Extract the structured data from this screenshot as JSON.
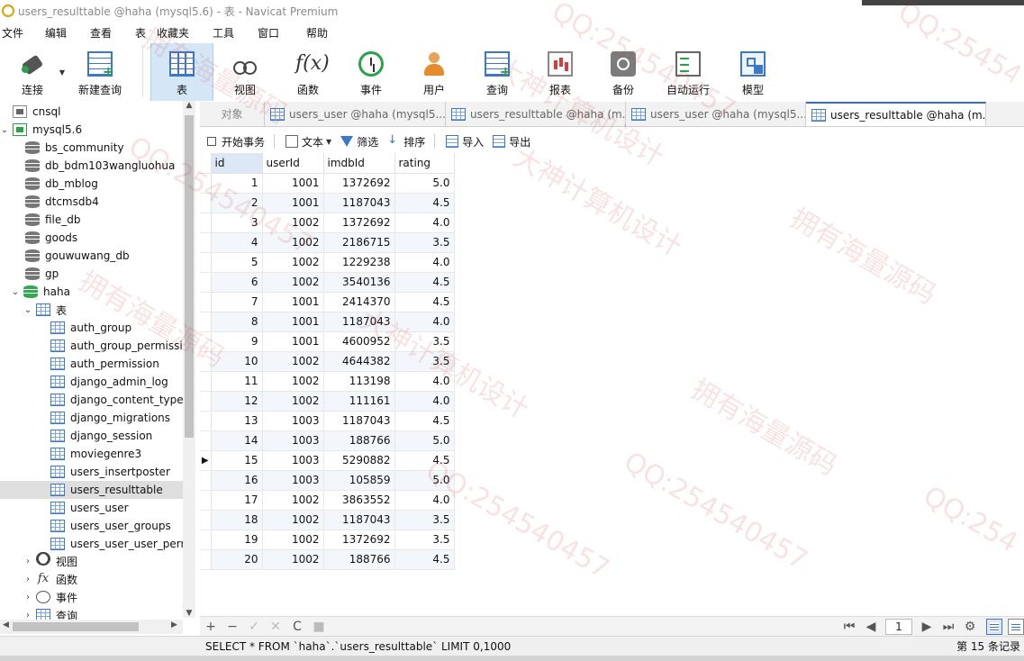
{
  "window": {
    "title": "users_resulttable @haha (mysql5.6) - 表 - Navicat Premium"
  },
  "menu": [
    "文件",
    "编辑",
    "查看",
    "表",
    "收藏夹",
    "工具",
    "窗口",
    "帮助"
  ],
  "toolbar": [
    {
      "label": "连接",
      "icon": "plug-icon"
    },
    {
      "label": "新建查询",
      "icon": "new-query-icon"
    },
    {
      "label": "表",
      "icon": "table-icon"
    },
    {
      "label": "视图",
      "icon": "view-glasses-icon"
    },
    {
      "label": "函数",
      "icon": "function-icon"
    },
    {
      "label": "事件",
      "icon": "clock-icon"
    },
    {
      "label": "用户",
      "icon": "user-icon"
    },
    {
      "label": "查询",
      "icon": "query-icon"
    },
    {
      "label": "报表",
      "icon": "report-icon"
    },
    {
      "label": "备份",
      "icon": "backup-icon"
    },
    {
      "label": "自动运行",
      "icon": "auto-run-icon"
    },
    {
      "label": "模型",
      "icon": "model-icon"
    }
  ],
  "tree": {
    "connections": [
      "cnsql",
      "mysql5.6"
    ],
    "databases": [
      "bs_community",
      "db_bdm103wangluohua",
      "db_mblog",
      "dtcmsdb4",
      "file_db",
      "goods",
      "gouwuwang_db",
      "gp",
      "haha"
    ],
    "tables_label": "表",
    "tables": [
      "auth_group",
      "auth_group_permissio",
      "auth_permission",
      "django_admin_log",
      "django_content_type",
      "django_migrations",
      "django_session",
      "moviegenre3",
      "users_insertposter",
      "users_resulttable",
      "users_user",
      "users_user_groups",
      "users_user_user_perm"
    ],
    "other_nodes": [
      "视图",
      "函数",
      "事件",
      "查询"
    ]
  },
  "tabs": {
    "objects": "对象",
    "items": [
      "users_user @haha (mysql5....",
      "users_resulttable @haha (m...",
      "users_user @haha (mysql5....",
      "users_resulttable @haha (m..."
    ]
  },
  "subtoolbar": {
    "begin_tx": "开始事务",
    "text": "文本",
    "filter": "筛选",
    "sort": "排序",
    "import": "导入",
    "export": "导出"
  },
  "grid": {
    "columns": [
      "id",
      "userId",
      "imdbId",
      "rating"
    ],
    "rows": [
      [
        "1",
        "1001",
        "1372692",
        "5.0"
      ],
      [
        "2",
        "1001",
        "1187043",
        "4.5"
      ],
      [
        "3",
        "1002",
        "1372692",
        "4.0"
      ],
      [
        "4",
        "1002",
        "2186715",
        "3.5"
      ],
      [
        "5",
        "1002",
        "1229238",
        "4.0"
      ],
      [
        "6",
        "1002",
        "3540136",
        "4.5"
      ],
      [
        "7",
        "1001",
        "2414370",
        "4.5"
      ],
      [
        "8",
        "1001",
        "1187043",
        "4.0"
      ],
      [
        "9",
        "1001",
        "4600952",
        "3.5"
      ],
      [
        "10",
        "1002",
        "4644382",
        "3.5"
      ],
      [
        "11",
        "1002",
        "113198",
        "4.0"
      ],
      [
        "12",
        "1002",
        "111161",
        "4.0"
      ],
      [
        "13",
        "1003",
        "1187043",
        "4.5"
      ],
      [
        "14",
        "1003",
        "188766",
        "5.0"
      ],
      [
        "15",
        "1003",
        "5290882",
        "4.5"
      ],
      [
        "16",
        "1003",
        "105859",
        "5.0"
      ],
      [
        "17",
        "1002",
        "3863552",
        "4.0"
      ],
      [
        "18",
        "1002",
        "1187043",
        "3.5"
      ],
      [
        "19",
        "1002",
        "1372692",
        "3.5"
      ],
      [
        "20",
        "1002",
        "188766",
        "4.5"
      ]
    ],
    "current_row_marker": "▶"
  },
  "navbar": {
    "add": "+",
    "remove": "−",
    "apply": "✓",
    "cancel": "✕",
    "refresh": "C",
    "stop": "■",
    "first": "⏮",
    "prev": "◀",
    "page": "1",
    "next": "▶",
    "last": "⏭",
    "settings": "⚙"
  },
  "status": {
    "sql": "SELECT * FROM `haha`.`users_resulttable` LIMIT 0,1000",
    "record_count": "第 15 条记录"
  },
  "watermarks": [
    "QQ:254540457",
    "拥有海量源码",
    "大神计算机设计",
    "QQ:254540457",
    "拥有海量源码",
    "QQ:254540457",
    "大神计算机设计",
    "拥有海量源码",
    "QQ:254540457",
    "大神计算机设计",
    "QQ:254540457",
    "拥有海量源码",
    "QQ:25454"
  ],
  "colors": {
    "accent": "#2f6fc6",
    "selected_toolbar": "#d5e6f7",
    "watermark": "#c83c3c"
  }
}
